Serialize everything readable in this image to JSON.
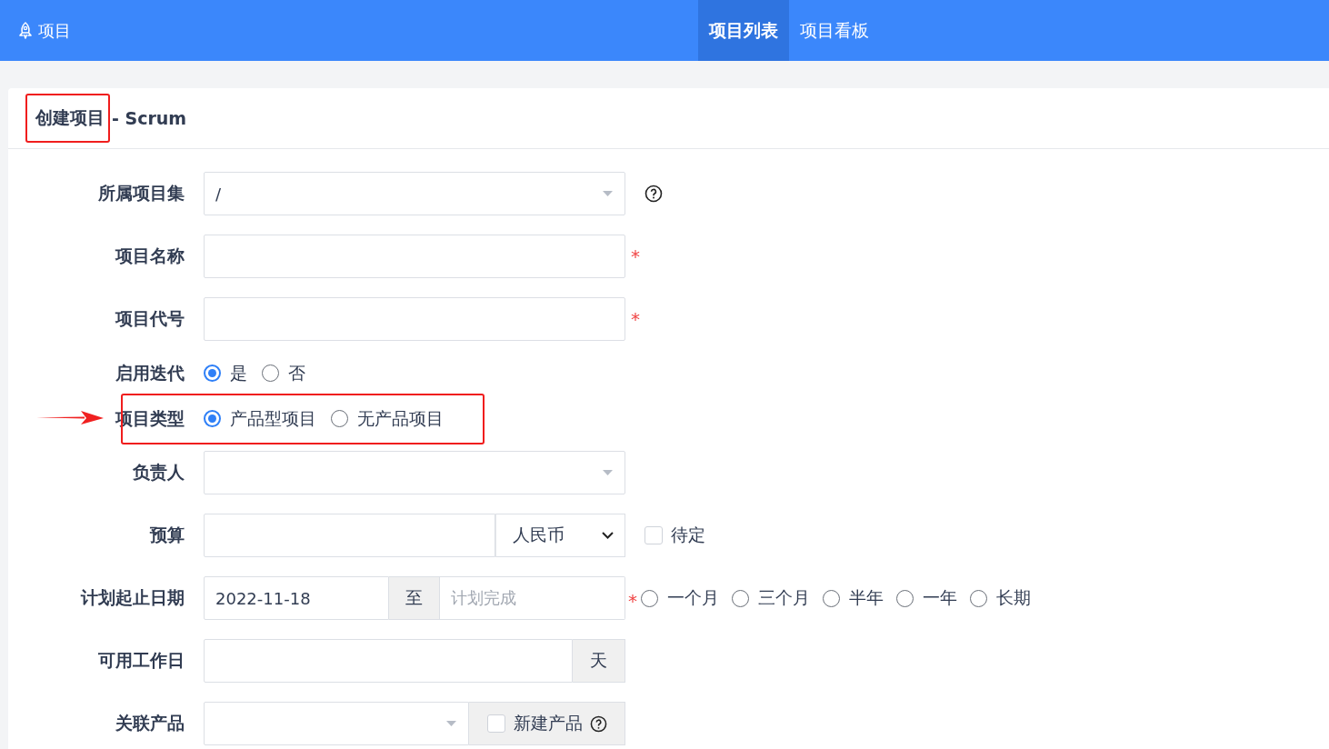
{
  "header": {
    "app": "项目",
    "nav": [
      {
        "label": "项目列表",
        "selected": true
      },
      {
        "label": "项目看板",
        "selected": false
      }
    ]
  },
  "panel": {
    "title": "创建项目",
    "subtitle": "- Scrum",
    "title_highlighted": true
  },
  "fields": [
    {
      "kind": "select",
      "label": "所属项目集",
      "value": "/",
      "help": true
    },
    {
      "kind": "text",
      "label": "项目名称",
      "required_mark": "*"
    },
    {
      "kind": "text",
      "label": "项目代号",
      "required_mark": "*"
    },
    {
      "kind": "radio",
      "label": "启用迭代",
      "highlighted": false,
      "options": [
        {
          "label": "是",
          "selected": true
        },
        {
          "label": "否",
          "selected": false
        }
      ]
    },
    {
      "kind": "radio",
      "label": "项目类型",
      "highlighted": true,
      "options": [
        {
          "label": "产品型项目",
          "selected": true
        },
        {
          "label": "无产品项目",
          "selected": false
        }
      ]
    },
    {
      "kind": "select",
      "label": "负责人"
    },
    {
      "kind": "budget",
      "label": "预算",
      "currency": "人民币",
      "checkbox": {
        "label": "待定",
        "checked": false
      }
    },
    {
      "kind": "daterange",
      "label": "计划起止日期",
      "start": "2022-11-18",
      "separator": "至",
      "end_placeholder": "计划完成",
      "required_mark": "*",
      "options": [
        {
          "label": "一个月",
          "selected": false
        },
        {
          "label": "三个月",
          "selected": false
        },
        {
          "label": "半年",
          "selected": false
        },
        {
          "label": "一年",
          "selected": false
        },
        {
          "label": "长期",
          "selected": false
        }
      ]
    },
    {
      "kind": "addon",
      "label": "可用工作日",
      "addon": "天"
    },
    {
      "kind": "product",
      "label": "关联产品",
      "checkbox": {
        "label": "新建产品",
        "checked": false
      },
      "help": true
    }
  ]
}
